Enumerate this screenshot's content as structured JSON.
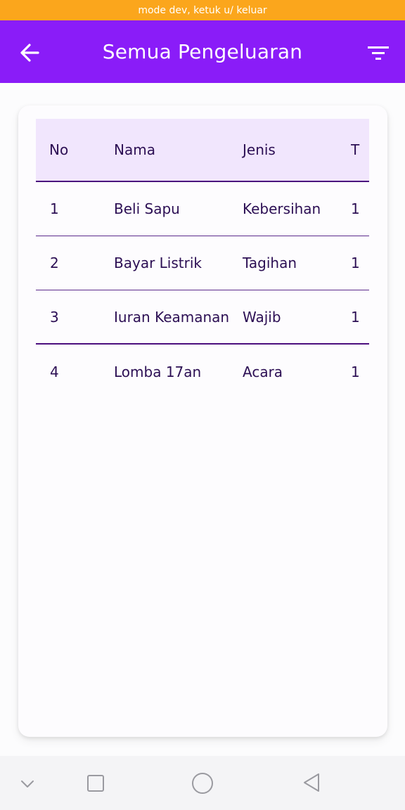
{
  "dev_banner": "mode dev, ketuk u/ keluar",
  "appbar": {
    "title": "Semua Pengeluaran",
    "back_icon": "arrow-left-icon",
    "filter_icon": "filter-icon"
  },
  "table": {
    "headers": {
      "no": "No",
      "nama": "Nama",
      "jenis": "Jenis",
      "partial": "T"
    },
    "rows": [
      {
        "no": "1",
        "nama": "Beli Sapu",
        "jenis": "Kebersihan",
        "partial": "1"
      },
      {
        "no": "2",
        "nama": "Bayar Listrik",
        "jenis": "Tagihan",
        "partial": "1"
      },
      {
        "no": "3",
        "nama": "Iuran Keamanan",
        "jenis": "Wajib",
        "partial": "1"
      },
      {
        "no": "4",
        "nama": "Lomba 17an",
        "jenis": "Acara",
        "partial": "1"
      }
    ]
  },
  "colors": {
    "banner": "#fba61c",
    "appbar": "#8a1cf8",
    "header_bg": "#f1e6fd",
    "text": "#2c0f54"
  },
  "navbar": {
    "icons": [
      "chevron-down-icon",
      "recent-apps-icon",
      "home-icon",
      "back-icon"
    ]
  }
}
